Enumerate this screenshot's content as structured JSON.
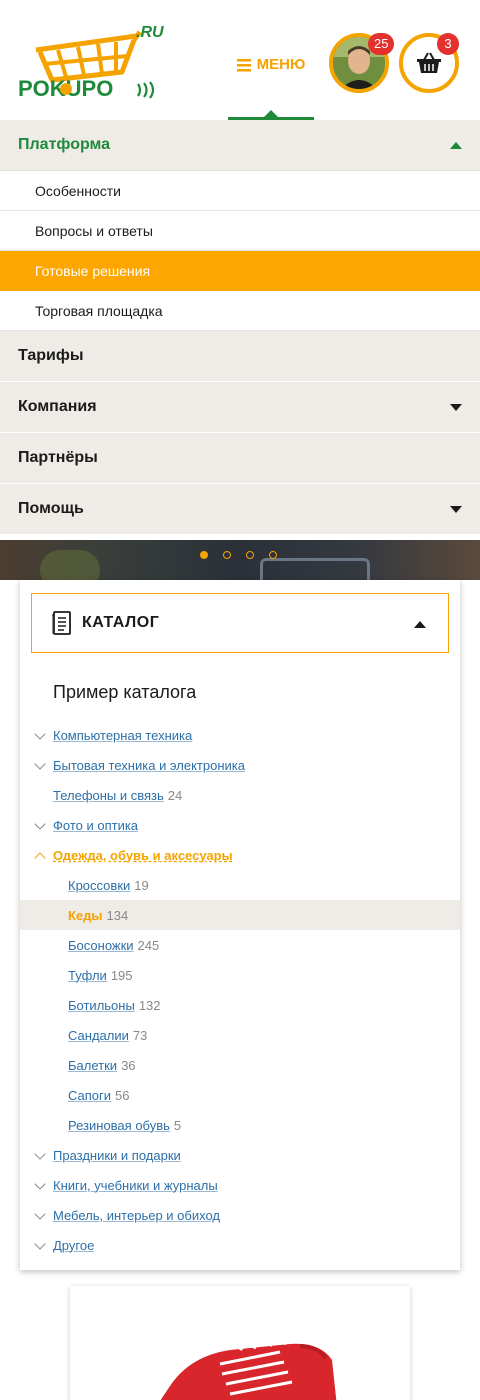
{
  "header": {
    "logo_text": "POKUPO",
    "logo_domain": ".RU",
    "menu_label": "МЕНЮ",
    "notifications_count": "25",
    "cart_count": "3"
  },
  "nav": {
    "open_section": "Платформа",
    "sub_items": [
      "Особенности",
      "Вопросы и ответы",
      "Готовые решения",
      "Торговая площадка"
    ],
    "active_sub": "Готовые решения",
    "sections": [
      {
        "label": "Тарифы",
        "has_arrow": false
      },
      {
        "label": "Компания",
        "has_arrow": true
      },
      {
        "label": "Партнёры",
        "has_arrow": false
      },
      {
        "label": "Помощь",
        "has_arrow": true
      }
    ]
  },
  "slider": {
    "dots": 4,
    "active_index": 0
  },
  "catalog": {
    "title": "КАТАЛОГ",
    "name": "Пример каталога",
    "items": [
      {
        "label": "Компьютерная техника",
        "count": "",
        "chevron": "down",
        "level": 1
      },
      {
        "label": "Бытовая техника и электроника",
        "count": "",
        "chevron": "down",
        "level": 1
      },
      {
        "label": "Телефоны и связь",
        "count": "24",
        "chevron": "",
        "level": 1
      },
      {
        "label": "Фото и оптика",
        "count": "",
        "chevron": "down",
        "level": 1
      },
      {
        "label": "Одежда, обувь и аксесуары",
        "count": "",
        "chevron": "up",
        "level": 1,
        "open": true
      },
      {
        "label": "Кроссовки",
        "count": "19",
        "chevron": "",
        "level": 2
      },
      {
        "label": "Кеды",
        "count": "134",
        "chevron": "",
        "level": 2,
        "selected": true
      },
      {
        "label": "Босоножки",
        "count": "245",
        "chevron": "",
        "level": 2
      },
      {
        "label": "Туфли",
        "count": "195",
        "chevron": "",
        "level": 2
      },
      {
        "label": "Ботильоны",
        "count": "132",
        "chevron": "",
        "level": 2
      },
      {
        "label": "Сандалии",
        "count": "73",
        "chevron": "",
        "level": 2
      },
      {
        "label": "Балетки",
        "count": "36",
        "chevron": "",
        "level": 2
      },
      {
        "label": "Сапоги",
        "count": "56",
        "chevron": "",
        "level": 2
      },
      {
        "label": "Резиновая обувь",
        "count": "5",
        "chevron": "",
        "level": 2
      },
      {
        "label": "Праздники и подарки",
        "count": "",
        "chevron": "down",
        "level": 1
      },
      {
        "label": "Книги, учебники и журналы",
        "count": "",
        "chevron": "down",
        "level": 1
      },
      {
        "label": "Мебель, интерьер и обиход",
        "count": "",
        "chevron": "down",
        "level": 1
      },
      {
        "label": "Другое",
        "count": "",
        "chevron": "down",
        "level": 1
      }
    ]
  },
  "colors": {
    "accent": "#f5a300",
    "brand_green": "#1e8a3a",
    "link": "#2d6fa8",
    "badge": "#e3312e",
    "nav_bg": "#efebe6"
  }
}
